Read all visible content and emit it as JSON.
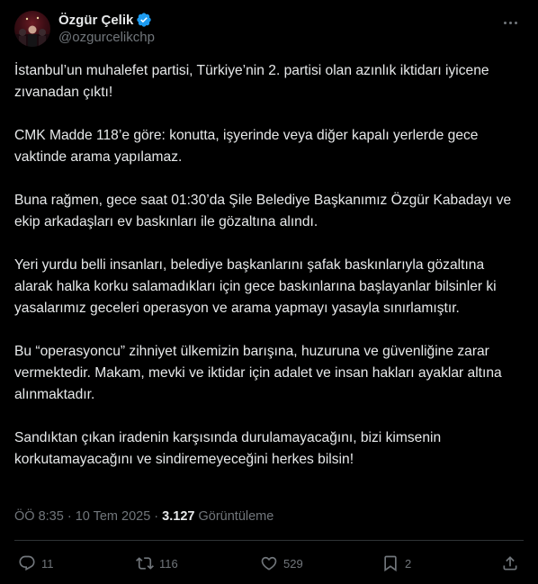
{
  "author": {
    "display_name": "Özgür Çelik",
    "handle": "@ozgurcelikchp",
    "verified_color": "#1d9bf0"
  },
  "tweet": {
    "paragraphs": [
      "İstanbul’un muhalefet partisi, Türkiye’nin 2. partisi olan azınlık iktidarı iyicene zıvanadan çıktı!",
      "CMK Madde 118’e göre: konutta, işyerinde veya diğer kapalı yerlerde gece vaktinde arama yapılamaz.",
      "Buna rağmen, gece saat 01:30’da Şile Belediye Başkanımız Özgür Kabadayı ve ekip arkadaşları ev baskınları ile gözaltına alındı.",
      "Yeri yurdu belli insanları, belediye başkanlarını şafak baskınlarıyla gözaltına alarak halka korku salamadıkları için gece baskınlarına başlayanlar bilsinler ki yasalarımız geceleri operasyon ve arama yapmayı yasayla sınırlamıştır.",
      "Bu “operasyoncu” zihniyet ülkemizin barışına, huzuruna ve güvenliğine zarar vermektedir. Makam, mevki ve iktidar için adalet ve insan hakları ayaklar altına alınmaktadır.",
      "Sandıktan çıkan iradenin karşısında durulamayacağını, bizi kimsenin korkutamayacağını ve sindiremeyeceğini herkes bilsin!"
    ]
  },
  "meta": {
    "time": "ÖÖ 8:35",
    "separator": " · ",
    "date": "10 Tem 2025",
    "views_count": "3.127",
    "views_label": "Görüntüleme"
  },
  "actions": {
    "replies": "11",
    "reposts": "116",
    "likes": "529",
    "bookmarks": "2"
  },
  "icons": {
    "more": "more-horizontal-icon",
    "reply": "reply-icon",
    "repost": "repost-icon",
    "like": "heart-icon",
    "bookmark": "bookmark-icon",
    "share": "share-icon",
    "verified": "verified-badge-icon"
  }
}
